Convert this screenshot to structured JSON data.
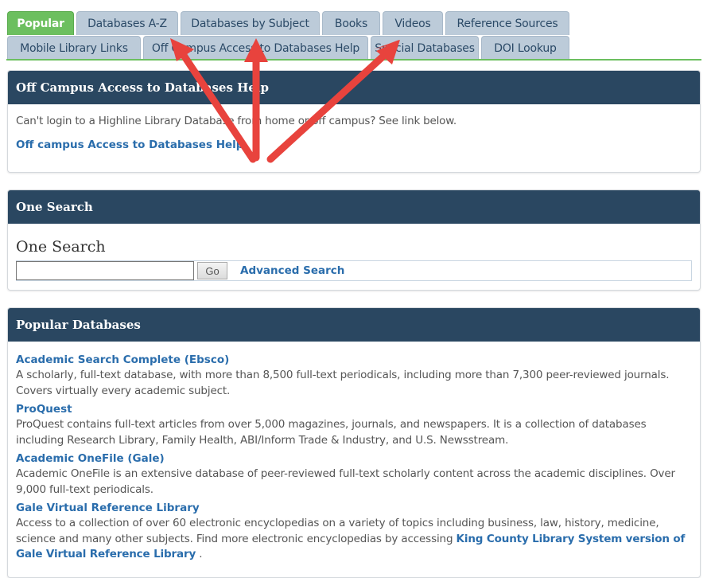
{
  "tabs": {
    "row1": [
      {
        "label": "Popular",
        "active": true
      },
      {
        "label": "Databases A-Z",
        "active": false
      },
      {
        "label": "Databases by Subject",
        "active": false
      },
      {
        "label": "Books",
        "active": false
      },
      {
        "label": "Videos",
        "active": false
      },
      {
        "label": "Reference Sources",
        "active": false
      }
    ],
    "row2": [
      {
        "label": "Mobile Library Links"
      },
      {
        "label": "Off Campus Access to Databases Help"
      },
      {
        "label": "Special Databases"
      },
      {
        "label": "DOI Lookup"
      }
    ]
  },
  "off_campus": {
    "title": "Off Campus Access to Databases Help",
    "description": "Can't login to a Highline Library Database from home or off campus?  See link below.",
    "link_label": "Off campus Access to Databases Help"
  },
  "one_search": {
    "panel_title": "One Search",
    "heading": "One Search",
    "input_value": "",
    "go_label": "Go",
    "advanced_label": "Advanced Search"
  },
  "popular": {
    "title": "Popular Databases",
    "items": [
      {
        "name": "Academic Search Complete (Ebsco)",
        "desc": "A scholarly, full-text database, with more than 8,500 full-text periodicals, including more than 7,300 peer-reviewed journals. Covers virtually every academic subject."
      },
      {
        "name": "ProQuest",
        "desc": "ProQuest contains full-text articles from over 5,000 magazines, journals, and newspapers.  It is a collection of databases including Research Library, Family Health, ABI/Inform Trade & Industry, and U.S. Newsstream."
      },
      {
        "name": "Academic OneFile (Gale)",
        "desc": "Academic OneFile is an extensive database of peer-reviewed full-text scholarly content across the academic disciplines. Over 9,000 full-text periodicals."
      },
      {
        "name": "Gale Virtual Reference Library",
        "desc": "Access to a collection of over 60 electronic encyclopedias on a variety of topics including business, law, history, medicine, science and many other subjects. Find more electronic encyclopedias by accessing",
        "inline_link": "King County Library System version of Gale Virtual Reference Library",
        "tail": " ."
      }
    ]
  },
  "colors": {
    "active_tab": "#6cbf5f",
    "tab_bg": "#bccbd9",
    "panel_header": "#2a4761",
    "link": "#2a6dac",
    "annotation_arrow": "#e8433d"
  }
}
